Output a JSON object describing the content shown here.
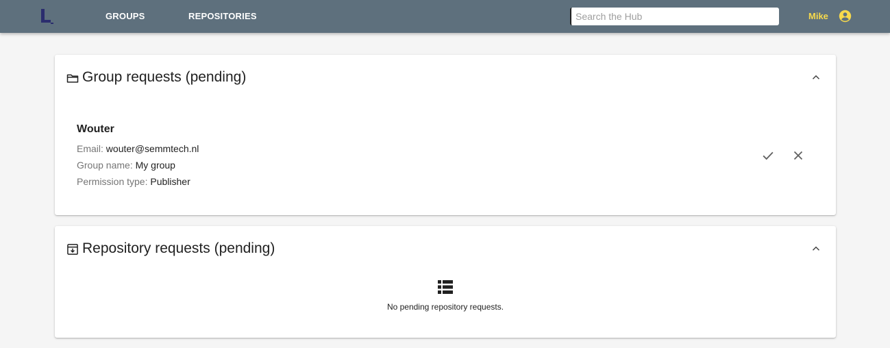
{
  "header": {
    "nav": [
      {
        "label": "GROUPS"
      },
      {
        "label": "REPOSITORIES"
      }
    ],
    "search": {
      "placeholder": "Search the Hub",
      "value": ""
    },
    "user": {
      "name": "Mike"
    },
    "colors": {
      "bar": "#5e707d",
      "user_accent": "#f7d94c",
      "logo": "#2b2d6e"
    }
  },
  "group_requests": {
    "title": "Group requests (pending)",
    "icon": "folder-icon",
    "items": [
      {
        "name": "Wouter",
        "email_label": "Email: ",
        "email": "wouter@semmtech.nl",
        "group_label": "Group name: ",
        "group": "My group",
        "permission_label": "Permission type: ",
        "permission": "Publisher"
      }
    ]
  },
  "repository_requests": {
    "title": "Repository requests (pending)",
    "icon": "archive-icon",
    "empty_message": "No pending repository requests.",
    "empty_icon": "list-icon"
  }
}
